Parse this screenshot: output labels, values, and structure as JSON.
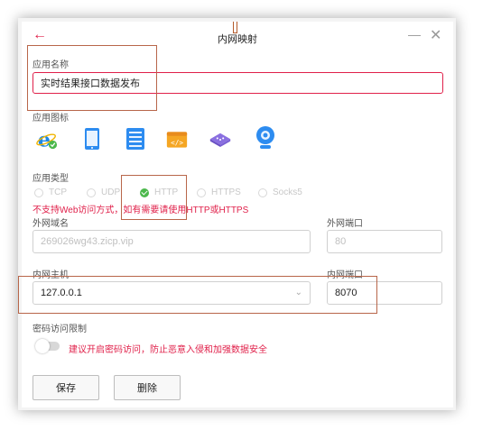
{
  "window": {
    "title": "内网映射"
  },
  "form": {
    "app_name_label": "应用名称",
    "app_name_value": "实时结果接口数据发布",
    "app_icon_label": "应用图标",
    "app_type_label": "应用类型",
    "app_types": [
      "TCP",
      "UDP",
      "HTTP",
      "HTTPS",
      "Socks5"
    ],
    "selected_type": "HTTP",
    "web_warning": "不支持Web访问方式，如有需要请使用HTTP或HTTPS",
    "domain_label": "外网域名",
    "domain_value": "269026wg43.zicp.vip",
    "ext_port_label": "外网端口",
    "ext_port_value": "80",
    "host_label": "内网主机",
    "host_value": "127.0.0.1",
    "int_port_label": "内网端口",
    "int_port_value": "8070",
    "password_label": "密码访问限制",
    "password_hint": "建议开启密码访问，防止恶意入侵和加强数据安全"
  },
  "buttons": {
    "save": "保存",
    "delete": "删除"
  },
  "icons": [
    "ie-icon",
    "phone-icon",
    "server-icon",
    "code-window-icon",
    "network-device-icon",
    "webcam-icon"
  ],
  "colors": {
    "accent": "#e0204a",
    "success": "#4cb84c",
    "annotation": "#b8664a"
  }
}
